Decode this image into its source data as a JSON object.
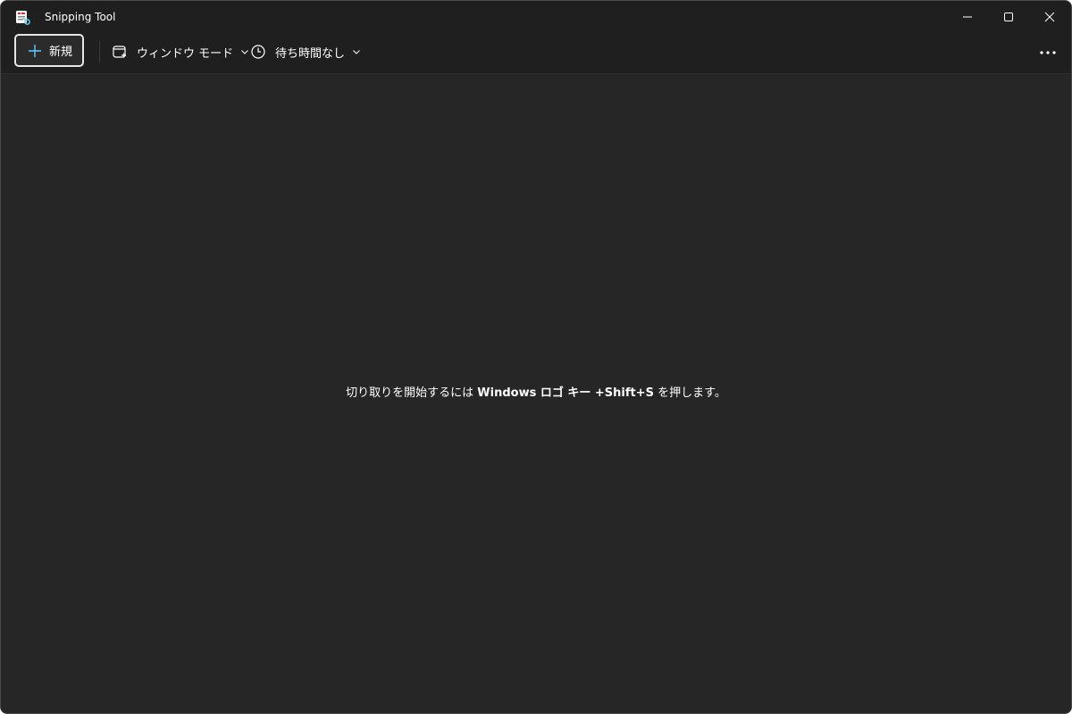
{
  "window": {
    "title": "Snipping Tool"
  },
  "toolbar": {
    "new_label": "新規",
    "mode_label": "ウィンドウ モード",
    "delay_label": "待ち時間なし"
  },
  "content": {
    "hint_prefix": "切り取りを開始するには ",
    "hint_key": "Windows ロゴ キー +Shift+S",
    "hint_suffix": " を押します。"
  },
  "icons": {
    "app": "snipping-tool-icon",
    "plus": "plus-icon",
    "mode": "window-mode-icon",
    "delay": "clock-icon",
    "chevron": "chevron-down-icon",
    "more": "more-icon",
    "minimize": "minimize-icon",
    "maximize": "maximize-icon",
    "close": "close-icon"
  },
  "colors": {
    "background": "#262626",
    "titlebar": "#1f1f1f",
    "accent": "#60cdff",
    "text": "#ffffff"
  }
}
